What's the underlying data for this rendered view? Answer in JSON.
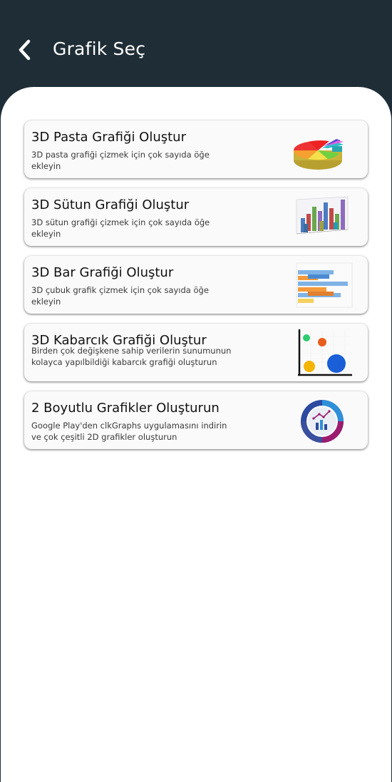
{
  "header": {
    "title": "Grafik Seç",
    "back_icon": "chevron-left-icon"
  },
  "cards": [
    {
      "title": "3D Pasta Grafiği Oluştur",
      "description": "3D pasta grafiği çizmek için çok sayıda öğe ekleyin",
      "icon": "pie-chart-3d-icon"
    },
    {
      "title": "3D Sütun Grafiği Oluştur",
      "description": "3D sütun grafiği çizmek için çok sayıda öğe ekleyin",
      "icon": "column-chart-3d-icon"
    },
    {
      "title": "3D Bar Grafiği Oluştur",
      "description": "3D çubuk grafik çizmek için çok sayıda öğe ekleyin",
      "icon": "bar-chart-3d-icon"
    },
    {
      "title": "3D Kabarcık Grafiği Oluştur",
      "description": "Birden çok değişkene sahip verilerin sunumunun kolayca yapılbildiği kabarcık grafiği oluşturun",
      "icon": "bubble-chart-icon"
    },
    {
      "title": "2 Boyutlu Grafikler Oluşturun",
      "description": "Google Play'den clkGraphs uygulamasını indirin ve çok çeşitli 2D grafikler oluşturun",
      "icon": "clkgraphs-app-icon"
    }
  ],
  "colors": {
    "appbar": "#1f2d36",
    "card": "#fafafa",
    "sheet": "#ffffff"
  }
}
